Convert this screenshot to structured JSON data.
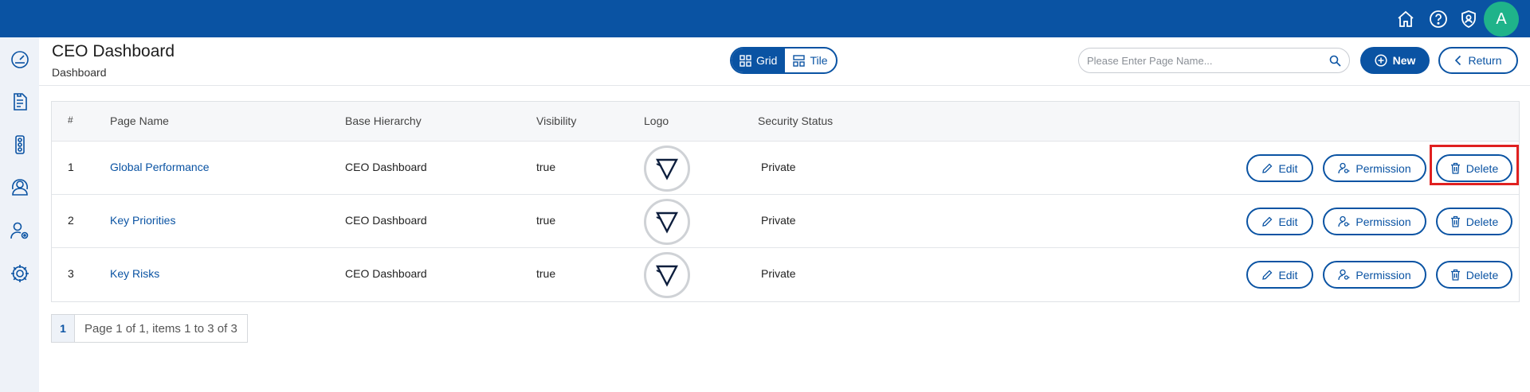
{
  "topbar": {
    "icons": [
      "home-icon",
      "help-icon",
      "shield-user-icon"
    ],
    "avatar_initial": "A",
    "accent": "#0a53a3",
    "avatar_color": "#1fb38a"
  },
  "sidenav": {
    "icons": [
      "dashboard-gauge-icon",
      "document-icon",
      "traffic-light-icon",
      "user-network-icon",
      "user-settings-icon",
      "gear-icon"
    ]
  },
  "header": {
    "title": "CEO Dashboard",
    "subtitle": "Dashboard",
    "view_toggle": {
      "grid_label": "Grid",
      "tile_label": "Tile",
      "active": "Grid"
    },
    "search_placeholder": "Please Enter Page Name...",
    "new_label": "New",
    "return_label": "Return"
  },
  "table": {
    "columns": [
      "#",
      "Page Name",
      "Base Hierarchy",
      "Visibility",
      "Logo",
      "Security Status"
    ],
    "rows": [
      {
        "num": "1",
        "page_name": "Global Performance",
        "base_hierarchy": "CEO Dashboard",
        "visibility": "true",
        "security_status": "Private"
      },
      {
        "num": "2",
        "page_name": "Key Priorities",
        "base_hierarchy": "CEO Dashboard",
        "visibility": "true",
        "security_status": "Private"
      },
      {
        "num": "3",
        "page_name": "Key Risks",
        "base_hierarchy": "CEO Dashboard",
        "visibility": "true",
        "security_status": "Private"
      }
    ],
    "actions": {
      "edit": "Edit",
      "permission": "Permission",
      "delete": "Delete"
    },
    "highlighted": "row-1-delete-button",
    "highlight_color": "#e02020"
  },
  "pager": {
    "current_page": "1",
    "info": "Page 1 of 1, items 1 to 3 of 3"
  }
}
